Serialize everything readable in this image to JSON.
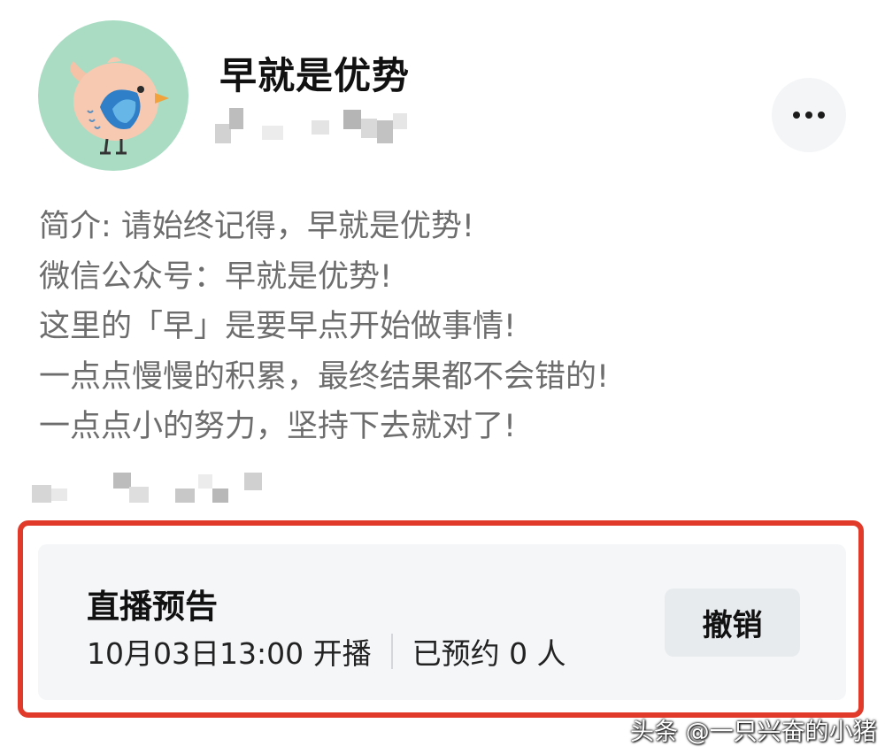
{
  "profile": {
    "name": "早就是优势",
    "bio_lines": [
      "简介: 请始终记得，早就是优势!",
      "微信公众号：早就是优势!",
      "这里的「早」是要早点开始做事情!",
      "一点点慢慢的积累，最终结果都不会错的!",
      "一点点小的努力，坚持下去就对了!"
    ]
  },
  "icons": {
    "avatar": "bird-avatar-icon",
    "more": "more-dots-icon"
  },
  "live_notice": {
    "title": "直播预告",
    "schedule": "10月03日13:00 开播",
    "reserved": "已预约 0 人",
    "cancel_label": "撤销"
  },
  "watermark": "头条 @一只兴奋的小猪",
  "colors": {
    "highlight_border": "#e23a2a",
    "avatar_bg": "#a9dcc3",
    "card_bg": "#f4f6f8"
  }
}
